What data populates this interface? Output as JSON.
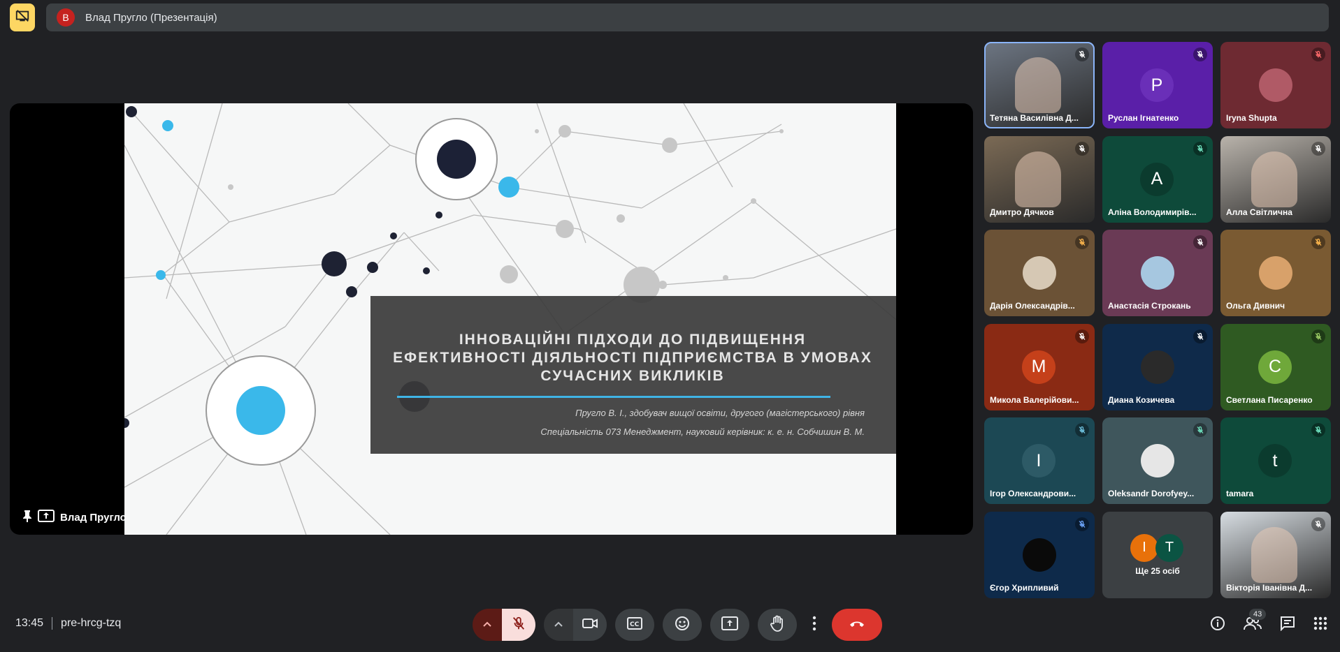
{
  "header": {
    "avatar_letter": "В",
    "title": "Влад Пругло (Презентація)"
  },
  "presentation": {
    "title": "ІННОВАЦІЙНІ ПІДХОДИ ДО ПІДВИЩЕННЯ ЕФЕКТИВНОСТІ ДІЯЛЬНОСТІ ПІДПРИЄМСТВА В УМОВАХ СУЧАСНИХ ВИКЛИКІВ",
    "author_line": "Пругло В. І., здобувач вищої освіти, другого (магістерського) рівня",
    "specialty_line": "Спеціальність 073 Менеджмент, науковий керівник: к. е. н. Собчишин В. М.",
    "presenter": "Влад Пругло"
  },
  "participants": [
    {
      "name": "Тетяна Василівна Д...",
      "type": "video",
      "bg": "#6d7683",
      "mic": "#ffffff"
    },
    {
      "name": "Руслан Ігнатенко",
      "type": "initial",
      "initial": "P",
      "bg": "#5a1fa8",
      "circle": "#6a2fb8",
      "mic": "#ffffff"
    },
    {
      "name": "Iryna Shupta",
      "type": "photo",
      "bg": "#6e2a32",
      "circle": "#b05a66",
      "mic": "#ff6b6b"
    },
    {
      "name": "Дмитро Дячков",
      "type": "video",
      "bg": "#7b6a55",
      "mic": "#ffffff"
    },
    {
      "name": "Аліна Володимирів...",
      "type": "initial",
      "initial": "A",
      "bg": "#0e4a3a",
      "circle": "#0b3b2e",
      "mic": "#6fe3c0"
    },
    {
      "name": "Алла Світлична",
      "type": "video",
      "bg": "#b9b3ab",
      "mic": "#ffffff"
    },
    {
      "name": "Дарія Олександрів...",
      "type": "photo",
      "bg": "#6b5236",
      "circle": "#d6c8b4",
      "mic": "#ffb74d"
    },
    {
      "name": "Анастасія Строкань",
      "type": "photo",
      "bg": "#6a3a55",
      "circle": "#a6c7e0",
      "mic": "#ffffff"
    },
    {
      "name": "Ольга Дивнич",
      "type": "photo",
      "bg": "#7a5a32",
      "circle": "#d8a16a",
      "mic": "#ffb74d"
    },
    {
      "name": "Микола Валерійови...",
      "type": "initial",
      "initial": "M",
      "bg": "#8a2a14",
      "circle": "#c5401a",
      "mic": "#ffffff"
    },
    {
      "name": "Диана Козичева",
      "type": "photo",
      "bg": "#0f2a4a",
      "circle": "#2a2a2a",
      "mic": "#ffffff"
    },
    {
      "name": "Светлана Писаренко",
      "type": "initial",
      "initial": "C",
      "bg": "#2f5a22",
      "circle": "#6fa83a",
      "mic": "#9ccc65"
    },
    {
      "name": "Ігор Олександрови...",
      "type": "initial",
      "initial": "I",
      "bg": "#1c4854",
      "circle": "#2d5a66",
      "mic": "#6fc3e0"
    },
    {
      "name": "Oleksandr Dorofyey...",
      "type": "photo",
      "bg": "#3f565c",
      "circle": "#e6e6e6",
      "mic": "#6fe3c0"
    },
    {
      "name": "tamara",
      "type": "initial",
      "initial": "t",
      "bg": "#0e4a3a",
      "circle": "#0b3b2e",
      "mic": "#6fe3c0"
    },
    {
      "name": "Єгор Хрипливий",
      "type": "photo",
      "bg": "#0e2a4a",
      "circle": "#0a0a0a",
      "mic": "#6fa8ff"
    },
    {
      "name": "Ще 25 осіб",
      "type": "more",
      "bg": "#3c4043",
      "letters": [
        "I",
        "T"
      ],
      "mic": ""
    },
    {
      "name": "Вікторія Іванівна Д...",
      "type": "video",
      "bg": "#d7dde2",
      "mic": "#ffffff"
    }
  ],
  "meeting": {
    "time": "13:45",
    "code": "pre-hrcg-tzq",
    "people_count": "43"
  }
}
